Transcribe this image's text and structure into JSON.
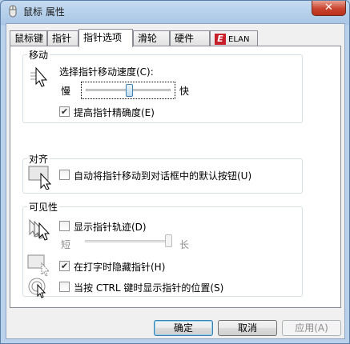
{
  "window": {
    "title": "鼠标 属性",
    "close_label": "✕"
  },
  "tabs": [
    {
      "label": "鼠标键"
    },
    {
      "label": "指针"
    },
    {
      "label": "指针选项"
    },
    {
      "label": "滑轮"
    },
    {
      "label": "硬件"
    },
    {
      "label": "ELAN",
      "icon": "elan-logo-icon",
      "logo_text": "E"
    }
  ],
  "active_tab": "指针选项",
  "motion": {
    "group_label": "移动",
    "speed_label": "选择指针移动速度(C):",
    "slow_label": "慢",
    "fast_label": "快",
    "speed_value": 0.5,
    "precision_label": "提高指针精确度(E)",
    "precision_checked": true
  },
  "snap_to": {
    "group_label": "对齐",
    "snap_label": "自动将指针移动到对话框中的默认按钮(U)",
    "snap_checked": false
  },
  "visibility": {
    "group_label": "可见性",
    "trails_label": "显示指针轨迹(D)",
    "trails_checked": false,
    "short_label": "短",
    "long_label": "长",
    "trails_value": 1.0,
    "hide_typing_label": "在打字时隐藏指针(H)",
    "hide_typing_checked": true,
    "ctrl_label": "当按 CTRL 键时显示指针的位置(S)",
    "ctrl_checked": false
  },
  "buttons": {
    "ok_label": "确定",
    "cancel_label": "取消",
    "apply_label": "应用(A)"
  },
  "check_glyph": "✔"
}
